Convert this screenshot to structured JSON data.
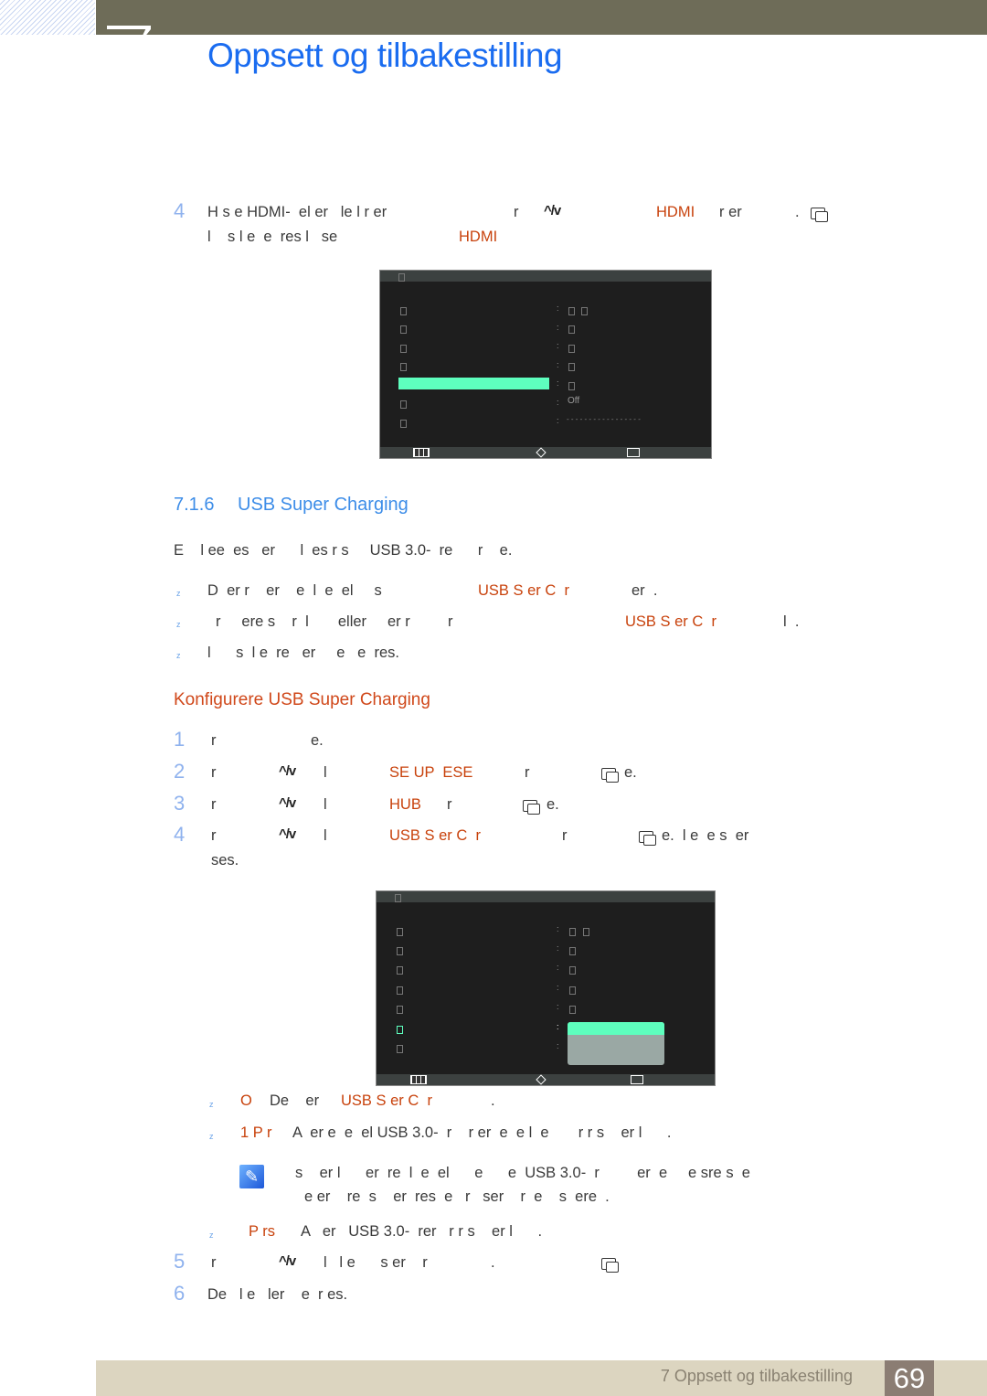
{
  "header": {
    "chapter_title": "Oppsett og tilbakestilling"
  },
  "step4a": {
    "num": "4",
    "t1": "H s e HDMI-  el er   le l r er",
    "t2": "r",
    "o1": "HDMI",
    "t3": "r er",
    "t4": ".",
    "l2": "l    s l e  e  res l   se",
    "o2": "HDMI"
  },
  "screen1": {
    "value_off": "Off",
    "dashes": "- - - - - - - - - - - - - - - - -"
  },
  "section": {
    "number": "7.1.6",
    "title": "USB Super Charging"
  },
  "intro": "E    l ee  es   er      l  es r s     USB 3.0-  re      r    e.",
  "bullets": [
    {
      "t1": "D  er r    er    e  l  e  el     s",
      "o": "USB S er C  r",
      "t2": "er  ."
    },
    {
      "t1": "r     ere s    r  l       eller     er r         r",
      "o": "USB S er C  r",
      "t2": "l  ."
    },
    {
      "t1": "l      s  l e  re   er     e   e  res."
    }
  ],
  "subheading": "Konfigurere USB Super Charging",
  "steps": [
    {
      "num": "1",
      "t1": "r",
      "t2": "e."
    },
    {
      "num": "2",
      "t1": "r",
      "t2": "l",
      "o": "SE UP  ESE",
      "t3": "r",
      "t4": "e."
    },
    {
      "num": "3",
      "t1": "r",
      "t2": "l",
      "o": "HUB",
      "t3": "r",
      "t4": "e."
    },
    {
      "num": "4",
      "t1": "r",
      "t2": "l",
      "o": "USB S er C  r",
      "t3": "r",
      "t4": "e.  l e  e s  er",
      "t5": "ses."
    },
    {
      "num": "5",
      "t1": "r",
      "t2": "l   l e      s er    r",
      "t3": "."
    },
    {
      "num": "6",
      "t1": "De   l e   ler    e  r es."
    }
  ],
  "options": [
    {
      "o": "O",
      "t1": "De    er",
      "o2": "USB S er C  r",
      "t2": "."
    },
    {
      "o": "1 P r",
      "t1": "A  er e  e  el USB 3.0-  r    r er  e  e l  e       r r s    er l      ."
    },
    {
      "o": "P rs",
      "t1": "A   er   USB 3.0-  rer   r r s    er l      ."
    }
  ],
  "note": {
    "l1": "s    er l      er  re  l  e  el      e      e  USB 3.0-  r         er  e     e sre s  e",
    "l2": "e er    re  s    er  res  e   r   ser    r  e    s  ere  ."
  },
  "footer": {
    "chapter": "7 Oppsett og tilbakestilling",
    "page": "69"
  },
  "colors": {
    "title_blue": "#1a6cf0",
    "highlight_orange": "#c8420c",
    "menu_select": "#5effbe",
    "footer_bg": "#dcd5c0"
  }
}
